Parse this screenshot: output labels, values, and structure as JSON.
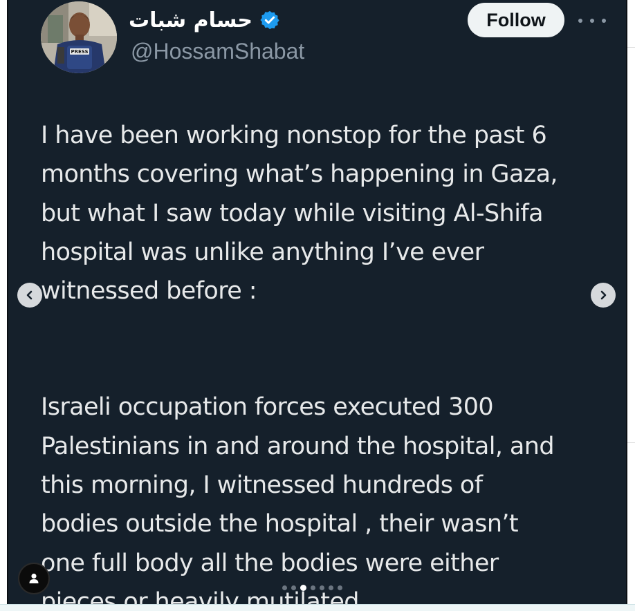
{
  "profile": {
    "display_name": "حسام شبات",
    "handle": "@HossamShabat",
    "verified_icon": "verified-badge-icon",
    "avatar_badge_text": "PRESS"
  },
  "actions": {
    "follow_label": "Follow",
    "more_icon": "more-dots-icon"
  },
  "tweet": {
    "paragraph_1": "I have been working nonstop for the past 6\nmonths covering what’s happening in Gaza,\nbut what I saw today while visiting Al-Shifa\nhospital was unlike anything I’ve ever\nwitnessed before :",
    "paragraph_2": "Israeli occupation forces executed 300\nPalestinians in and around the hospital, and\nthis morning, I witnessed hundreds of\nbodies outside the hospital , their wasn’t\none full body all the bodies were either\npieces or heavily mutilated ."
  },
  "carousel": {
    "prev_icon": "chevron-left-icon",
    "next_icon": "chevron-right-icon",
    "dot_count": 7,
    "active_dot": 3
  },
  "colors": {
    "card_background": "#15202b",
    "text_primary": "#e7e9ea",
    "text_secondary": "#8b98a5",
    "verified_blue": "#1d9bf0",
    "follow_button_bg": "#eff3f4"
  }
}
